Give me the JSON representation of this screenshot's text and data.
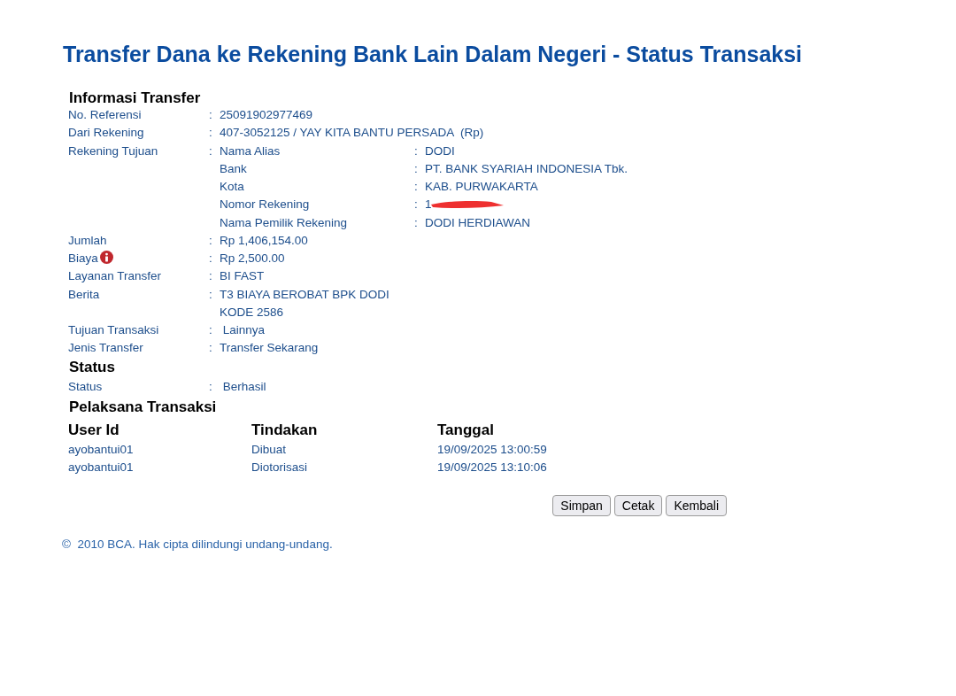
{
  "title": "Transfer Dana ke Rekening Bank Lain Dalam Negeri - Status Transaksi",
  "transfer_info": {
    "heading": "Informasi Transfer",
    "rows": [
      {
        "kind": "plain",
        "label": "No. Referensi",
        "sep": ":",
        "values": [
          "25091902977469"
        ]
      },
      {
        "kind": "plain",
        "label": "Dari Rekening",
        "sep": ":",
        "values": [
          "407-3052125 / YAY KITA BANTU PERSADA  (Rp)"
        ]
      },
      {
        "kind": "details",
        "label": "Rekening Tujuan",
        "sep": ":",
        "items": [
          {
            "label": "Nama Alias",
            "sep": ":",
            "value": "DODI",
            "redacted": false
          },
          {
            "label": "Bank",
            "sep": ":",
            "value": "PT. BANK SYARIAH INDONESIA Tbk.",
            "redacted": false
          },
          {
            "label": "Kota",
            "sep": ":",
            "value": "KAB. PURWAKARTA",
            "redacted": false
          },
          {
            "label": "Nomor Rekening",
            "sep": ":",
            "value": "1",
            "redacted": true
          },
          {
            "label": "Nama Pemilik Rekening",
            "sep": ":",
            "value": "DODI HERDIAWAN",
            "redacted": false
          }
        ]
      },
      {
        "kind": "plain",
        "label": "Jumlah",
        "sep": ":",
        "values": [
          "Rp 1,406,154.00"
        ]
      },
      {
        "kind": "plain",
        "label": "Biaya",
        "sep": ":",
        "info": true,
        "values": [
          "Rp 2,500.00"
        ]
      },
      {
        "kind": "plain",
        "label": "Layanan Transfer",
        "sep": ":",
        "values": [
          "BI FAST"
        ]
      },
      {
        "kind": "plain",
        "label": "Berita",
        "sep": ":",
        "values": [
          "T3 BIAYA BEROBAT BPK DODI",
          "KODE 2586"
        ]
      },
      {
        "kind": "plain",
        "label": "Tujuan Transaksi",
        "sep": ":",
        "values": [
          " Lainnya"
        ]
      },
      {
        "kind": "plain",
        "label": "Jenis Transfer",
        "sep": ":",
        "values": [
          "Transfer Sekarang"
        ]
      }
    ]
  },
  "status": {
    "heading": "Status",
    "rows": [
      {
        "kind": "plain",
        "label": "Status",
        "sep": ":",
        "values": [
          " Berhasil"
        ]
      }
    ]
  },
  "executors": {
    "heading": "Pelaksana Transaksi",
    "columns": [
      "User Id",
      "Tindakan",
      "Tanggal"
    ],
    "rows": [
      [
        "ayobantui01",
        "Dibuat",
        "19/09/2025 13:00:59"
      ],
      [
        "ayobantui01",
        "Diotorisasi",
        "19/09/2025 13:10:06"
      ]
    ]
  },
  "buttons": [
    "Simpan",
    "Cetak",
    "Kembali"
  ],
  "footer": "©  2010 BCA. Hak cipta dilindungi undang-undang."
}
